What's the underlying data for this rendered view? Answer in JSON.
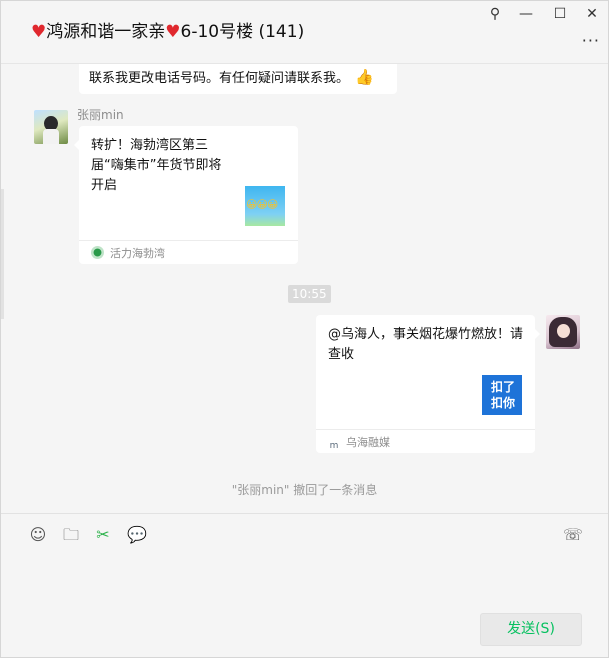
{
  "header": {
    "title": "鸿源和谐一家亲",
    "title_suffix": "6-10号楼 (141)",
    "heart_glyph": "♥",
    "pin_glyph": "⚲",
    "minimize_glyph": "—",
    "maximize_glyph": "☐",
    "close_glyph": "✕",
    "more_glyph": "···"
  },
  "messages": {
    "top_partial_text": "联系我更改电话号码。有任何疑问请联系我。",
    "top_partial_emoji": "👍",
    "left_sender": "张丽min",
    "left_card": {
      "title": "转扩！海勃湾区第三届“嗨集市”年货节即将开启",
      "thumb_emojis": "😀😀😀",
      "source": "活力海勃湾"
    },
    "timestamp": "10:55",
    "right_card": {
      "title": "@乌海人，事关烟花爆竹燃放！请查收",
      "thumb_text": "扣了扣你",
      "source": "乌海融媒",
      "source_icon_text": "m"
    },
    "recall_notice": "\"张丽min\" 撤回了一条消息"
  },
  "toolbar": {
    "emoji_icon_glyph": "☺",
    "folder_icon_glyph": "🗀",
    "scissors_icon_glyph": "✂",
    "chat_icon_glyph": "💬",
    "call_icon_glyph": "☏"
  },
  "send_button": "发送(S)",
  "colors": {
    "heart": "#e0282e",
    "send_text": "#07c160",
    "scissors": "#2db24b"
  }
}
